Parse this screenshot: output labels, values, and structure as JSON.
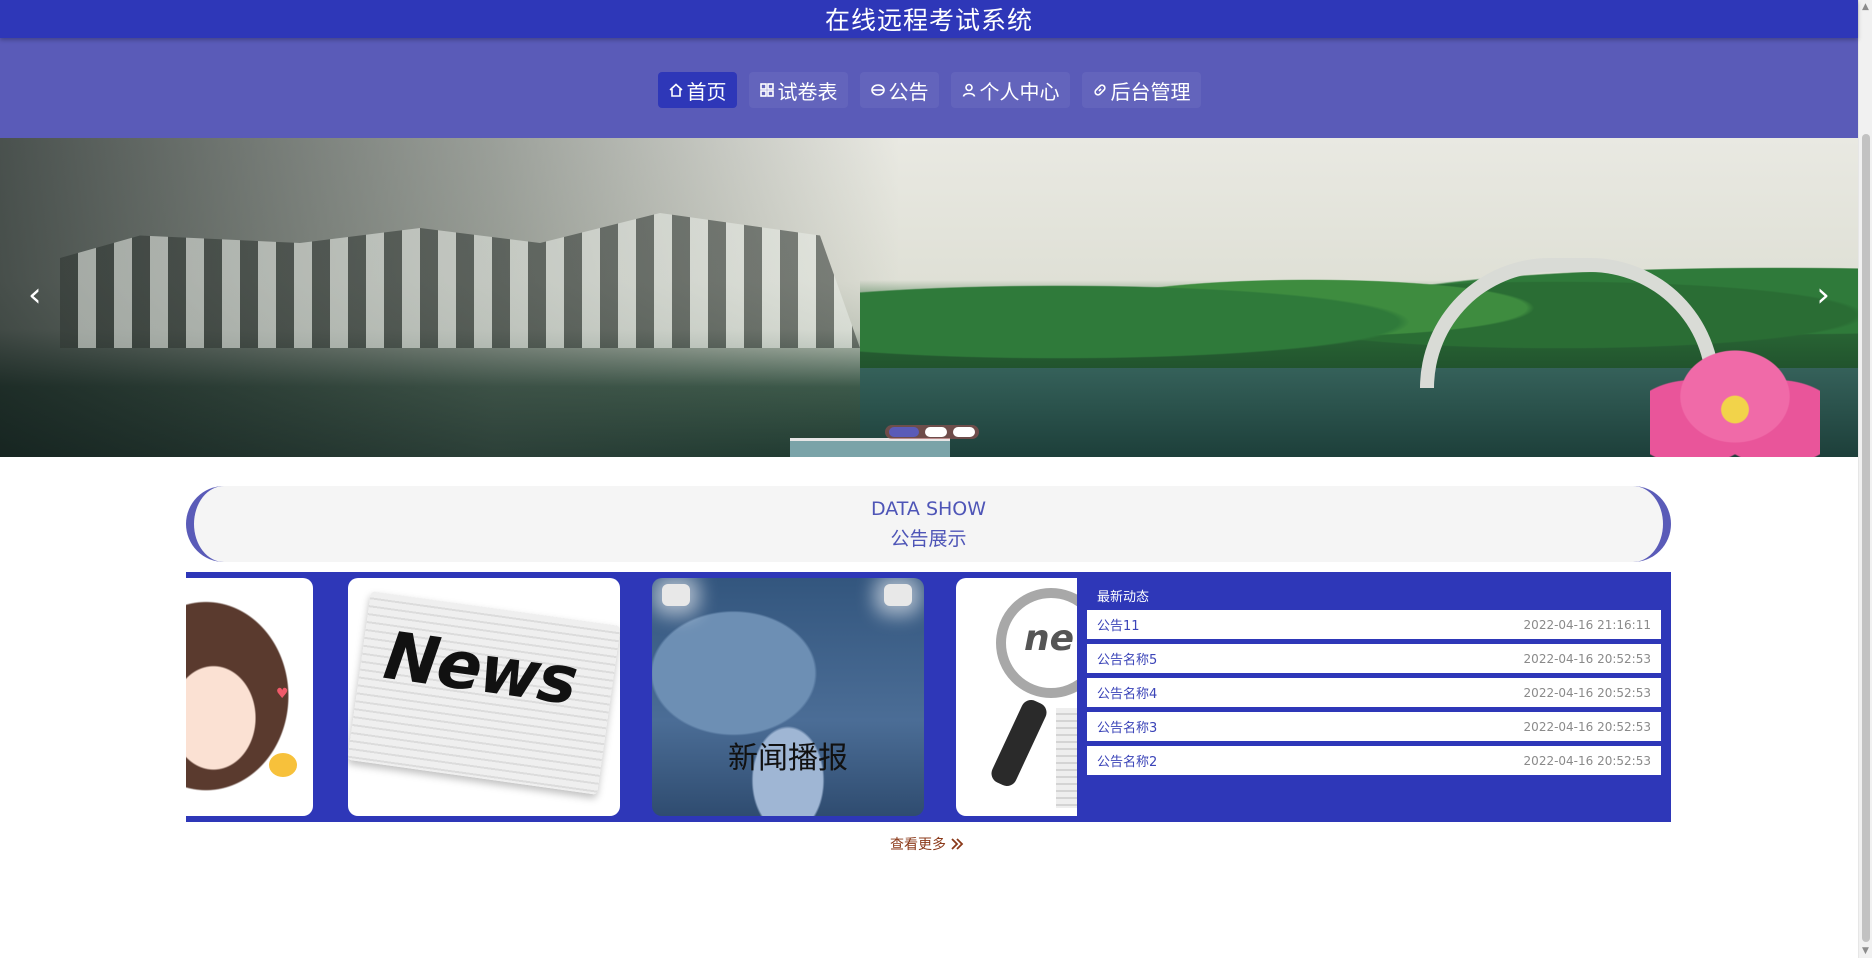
{
  "header": {
    "title": "在线远程考试系统"
  },
  "nav": {
    "items": [
      {
        "label": "首页",
        "icon": "home-icon",
        "active": true
      },
      {
        "label": "试卷表",
        "icon": "grid-icon",
        "active": false
      },
      {
        "label": "公告",
        "icon": "notice-icon",
        "active": false
      },
      {
        "label": "个人中心",
        "icon": "user-icon",
        "active": false
      },
      {
        "label": "后台管理",
        "icon": "link-icon",
        "active": false
      }
    ]
  },
  "banner": {
    "slide_count": 3,
    "active_slide": 1,
    "prev_icon": "chevron-left-icon",
    "next_icon": "chevron-right-icon"
  },
  "section": {
    "en_title": "DATA SHOW",
    "cn_title": "公告展示"
  },
  "cards": {
    "card3_caption": "新闻播报",
    "card2_word": "News",
    "card4_word": "new"
  },
  "latest": {
    "title": "最新动态",
    "items": [
      {
        "name": "公告11",
        "time": "2022-04-16 21:16:11"
      },
      {
        "name": "公告名称5",
        "time": "2022-04-16 20:52:53"
      },
      {
        "name": "公告名称4",
        "time": "2022-04-16 20:52:53"
      },
      {
        "name": "公告名称3",
        "time": "2022-04-16 20:52:53"
      },
      {
        "name": "公告名称2",
        "time": "2022-04-16 20:52:53"
      }
    ]
  },
  "more": {
    "label": "查看更多",
    "icon": "double-chevron-right-icon"
  },
  "colors": {
    "title_bar": "#2e37b8",
    "nav_bar": "#5a5bb8",
    "accent": "#2e37b8",
    "link": "#8b3a1a"
  }
}
